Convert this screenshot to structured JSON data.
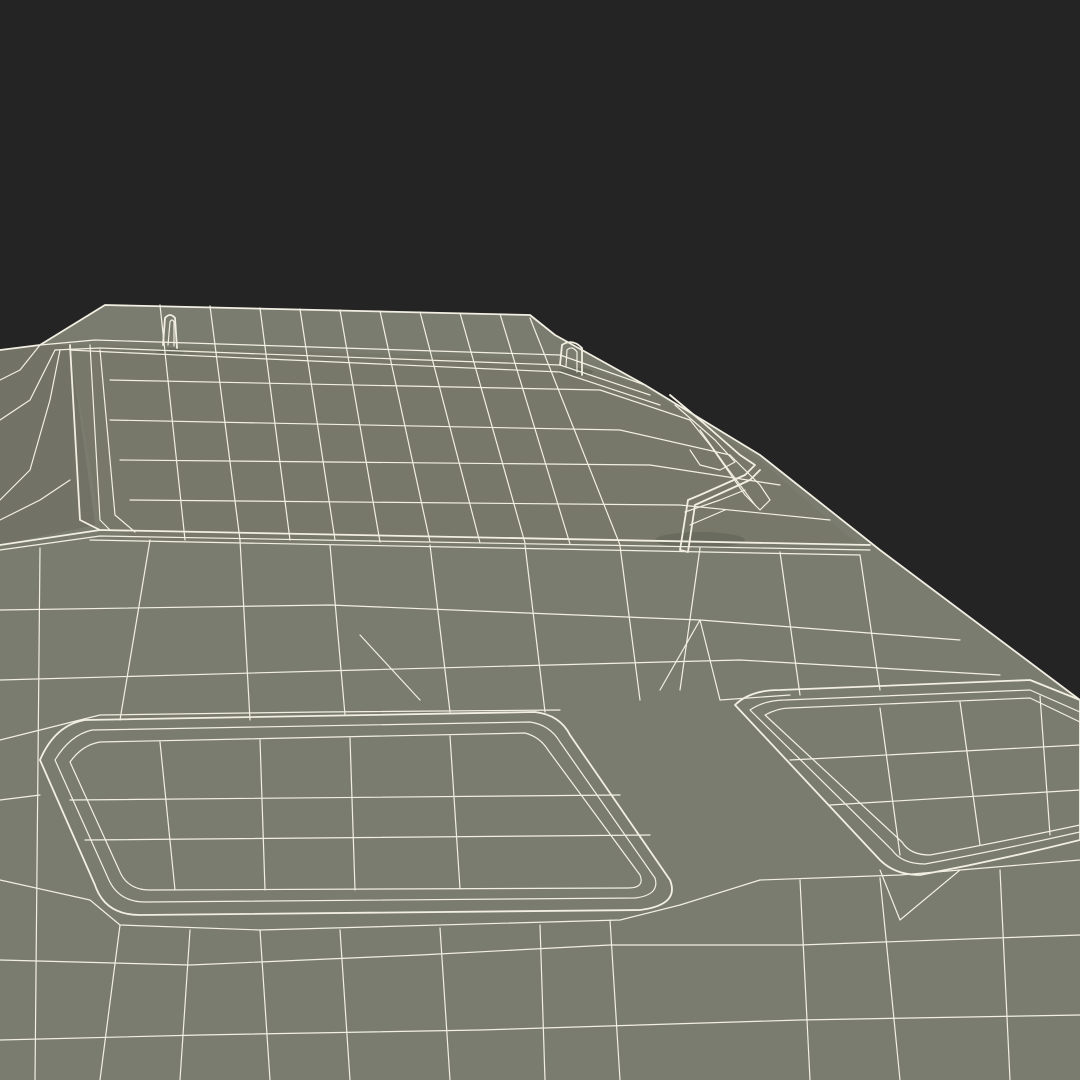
{
  "scene": {
    "kind": "3d-wireframe-render",
    "subject": "vehicle-roof",
    "background_color": "#242424",
    "surface_color": "#7b7c70",
    "surface_shade_color": "#6c6d62",
    "wire_color": "#f2efe2",
    "shadow_color": "#5f6058"
  }
}
